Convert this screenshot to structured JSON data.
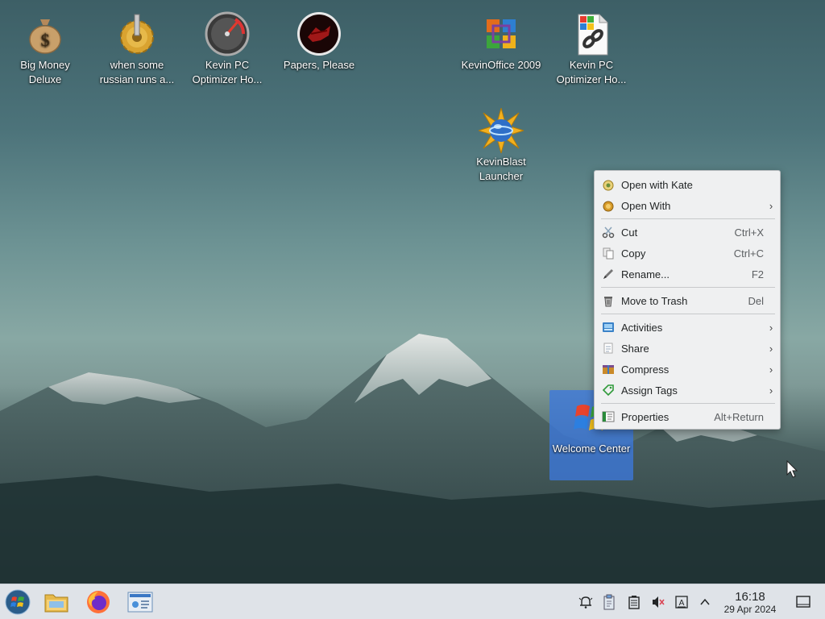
{
  "desktop": {
    "icons": [
      {
        "label": "Big Money Deluxe"
      },
      {
        "label": "when some russian runs a..."
      },
      {
        "label": "Kevin PC Optimizer Ho..."
      },
      {
        "label": "Papers, Please"
      },
      {
        "label": "KevinOffice 2009"
      },
      {
        "label": "Kevin PC Optimizer Ho..."
      },
      {
        "label": "KevinBlast Launcher"
      },
      {
        "label": "Welcome Center"
      }
    ]
  },
  "context_menu": {
    "items": [
      {
        "label": "Open with Kate",
        "shortcut": "",
        "icon": "kate-icon"
      },
      {
        "label": "Open With",
        "shortcut": "",
        "icon": "open-with-icon",
        "submenu": true
      },
      {
        "label": "Cut",
        "shortcut": "Ctrl+X",
        "icon": "scissors-icon"
      },
      {
        "label": "Copy",
        "shortcut": "Ctrl+C",
        "icon": "copy-icon"
      },
      {
        "label": "Rename...",
        "shortcut": "F2",
        "icon": "rename-icon"
      },
      {
        "label": "Move to Trash",
        "shortcut": "Del",
        "icon": "trash-icon"
      },
      {
        "label": "Activities",
        "shortcut": "",
        "icon": "activities-icon",
        "submenu": true
      },
      {
        "label": "Share",
        "shortcut": "",
        "icon": "share-icon",
        "submenu": true
      },
      {
        "label": "Compress",
        "shortcut": "",
        "icon": "compress-icon",
        "submenu": true
      },
      {
        "label": "Assign Tags",
        "shortcut": "",
        "icon": "tag-icon",
        "submenu": true
      },
      {
        "label": "Properties",
        "shortcut": "Alt+Return",
        "icon": "properties-icon"
      }
    ]
  },
  "taskbar": {
    "pinned": [
      {
        "icon": "start-menu-icon"
      },
      {
        "icon": "file-manager-icon"
      },
      {
        "icon": "firefox-icon"
      },
      {
        "icon": "system-settings-icon"
      }
    ],
    "tray": [
      {
        "icon": "notifications-icon"
      },
      {
        "icon": "clipboard-icon"
      },
      {
        "icon": "battery-device-icon"
      },
      {
        "icon": "volume-muted-icon"
      },
      {
        "icon": "input-method-icon"
      },
      {
        "icon": "chevron-up-icon"
      }
    ],
    "clock": {
      "time": "16:18",
      "date": "29 Apr 2024"
    },
    "show_desktop_icon": "show-desktop-icon"
  },
  "colors": {
    "selection": "#3c78dc",
    "taskbar": "#dfe3e8",
    "menu": "#eff0f1"
  }
}
